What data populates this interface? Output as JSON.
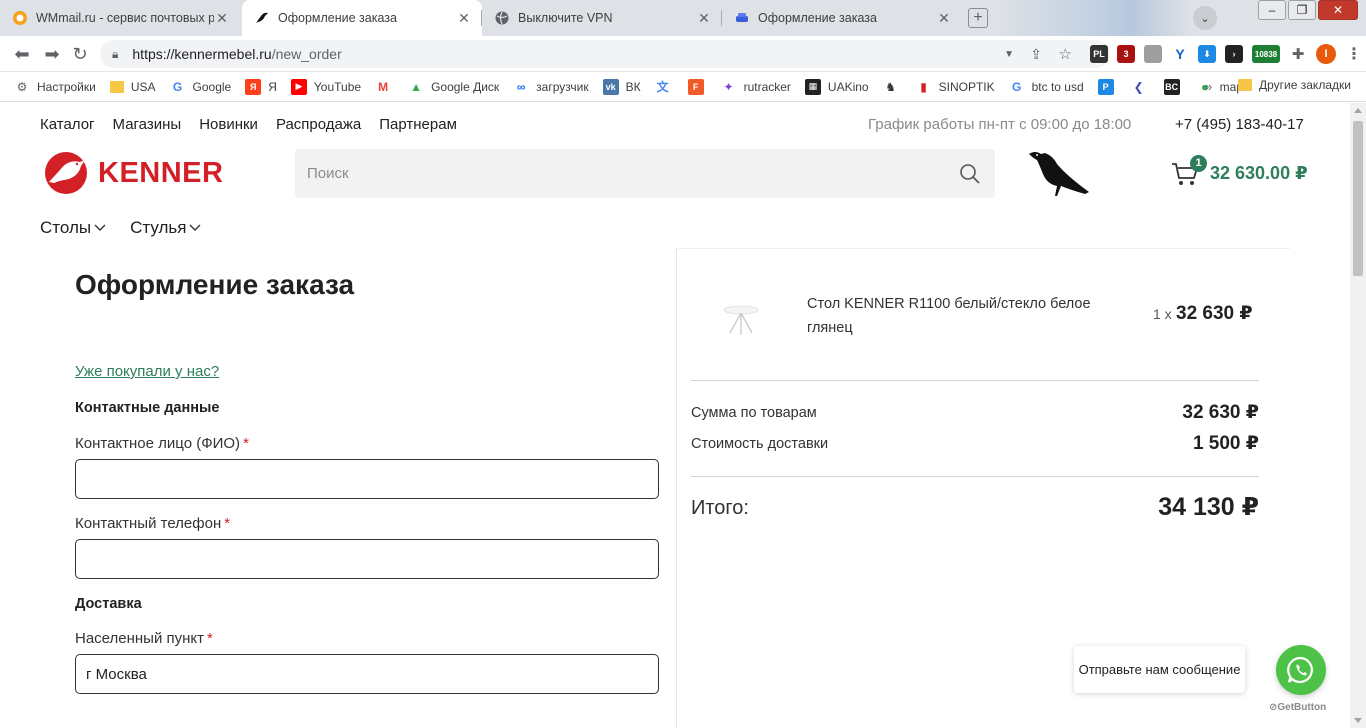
{
  "browser": {
    "tabs": [
      {
        "title": "WMmail.ru - сервис почтовых рассылок",
        "icon": "wmmail-icon"
      },
      {
        "title": "Оформление заказа",
        "icon": "kenner-bird-icon",
        "active": true
      },
      {
        "title": "Выключите VPN",
        "icon": "globe-icon"
      },
      {
        "title": "Оформление заказа",
        "icon": "sofa-icon"
      }
    ],
    "url_host": "https://kennermebel.ru",
    "url_path": "/new_order",
    "extension_badges": {
      "pl": "PL",
      "count3": "3",
      "counter": "10838"
    },
    "profile_initial": "I",
    "bookmarks": [
      {
        "label": "Настройки",
        "icon": "gear-icon",
        "color": "#5f6368"
      },
      {
        "label": "USA",
        "icon": "folder-icon",
        "color": "#f6c646"
      },
      {
        "label": "Google",
        "icon": "google-icon",
        "color": "#4285f4"
      },
      {
        "label": "Я",
        "icon": "yandex-icon",
        "color": "#fc3f1d"
      },
      {
        "label": "YouTube",
        "icon": "youtube-icon",
        "color": "#ff0000"
      },
      {
        "label": "",
        "icon": "gmail-icon",
        "color": "#ea4335"
      },
      {
        "label": "Google Диск",
        "icon": "google-drive-icon",
        "color": "#34a853"
      },
      {
        "label": "загрузчик",
        "icon": "infinity-icon",
        "color": "#1a73e8"
      },
      {
        "label": "ВК",
        "icon": "vk-icon",
        "color": "#4a76a8"
      },
      {
        "label": "",
        "icon": "translate-icon",
        "color": "#4285f4"
      },
      {
        "label": "",
        "icon": "f-icon",
        "color": "#f05a28"
      },
      {
        "label": "rutracker",
        "icon": "rutracker-icon",
        "color": "#7b3fe4"
      },
      {
        "label": "UAKino",
        "icon": "film-icon",
        "color": "#222222"
      },
      {
        "label": "",
        "icon": "chess-icon",
        "color": "#333333"
      },
      {
        "label": "SINOPTIK",
        "icon": "thermometer-icon",
        "color": "#d32027"
      },
      {
        "label": "btc to usd",
        "icon": "google-icon",
        "color": "#4285f4"
      },
      {
        "label": "",
        "icon": "p-icon",
        "color": "#1e88e5"
      },
      {
        "label": "",
        "icon": "arrow-left-icon",
        "color": "#3f51b5"
      },
      {
        "label": "",
        "icon": "bc-icon",
        "color": "#222222"
      },
      {
        "label": "maps",
        "icon": "maps-pin-icon",
        "color": "#34a853"
      }
    ],
    "bookmarks_more": "»",
    "other_bookmarks": "Другие закладки"
  },
  "site": {
    "top_nav": [
      "Каталог",
      "Магазины",
      "Новинки",
      "Распродажа",
      "Партнерам"
    ],
    "hours": "График работы пн-пт с 09:00 до 18:00",
    "phone": "+7 (495) 183-40-17",
    "logo_text": "KENNER",
    "search_placeholder": "Поиск",
    "cart_count": "1",
    "cart_total": "32 630.00 ₽",
    "category_nav": [
      "Столы",
      "Стулья"
    ],
    "brand_red": "#d32027",
    "accent_green": "#2e7d5b"
  },
  "order": {
    "title": "Оформление заказа",
    "returning_link": "Уже покупали у нас?",
    "contacts_heading": "Контактные данные",
    "name_label": "Контактное лицо (ФИО)",
    "name_value": "",
    "phone_label": "Контактный телефон",
    "phone_value": "",
    "delivery_heading": "Доставка",
    "city_label": "Населенный пункт",
    "city_value": "г Москва",
    "required_mark": "*"
  },
  "summary": {
    "item_name": "Стол KENNER R1100 белый/стекло белое глянец",
    "item_qty": "1 x",
    "item_price": "32 630 ₽",
    "goods_label": "Сумма по товарам",
    "goods_value": "32 630 ₽",
    "delivery_label": "Стоимость доставки",
    "delivery_value": "1 500 ₽",
    "total_label": "Итого:",
    "total_value": "34 130 ₽"
  },
  "chat": {
    "bubble_text": "Отправьте нам сообщение",
    "brand": "GetButton"
  }
}
